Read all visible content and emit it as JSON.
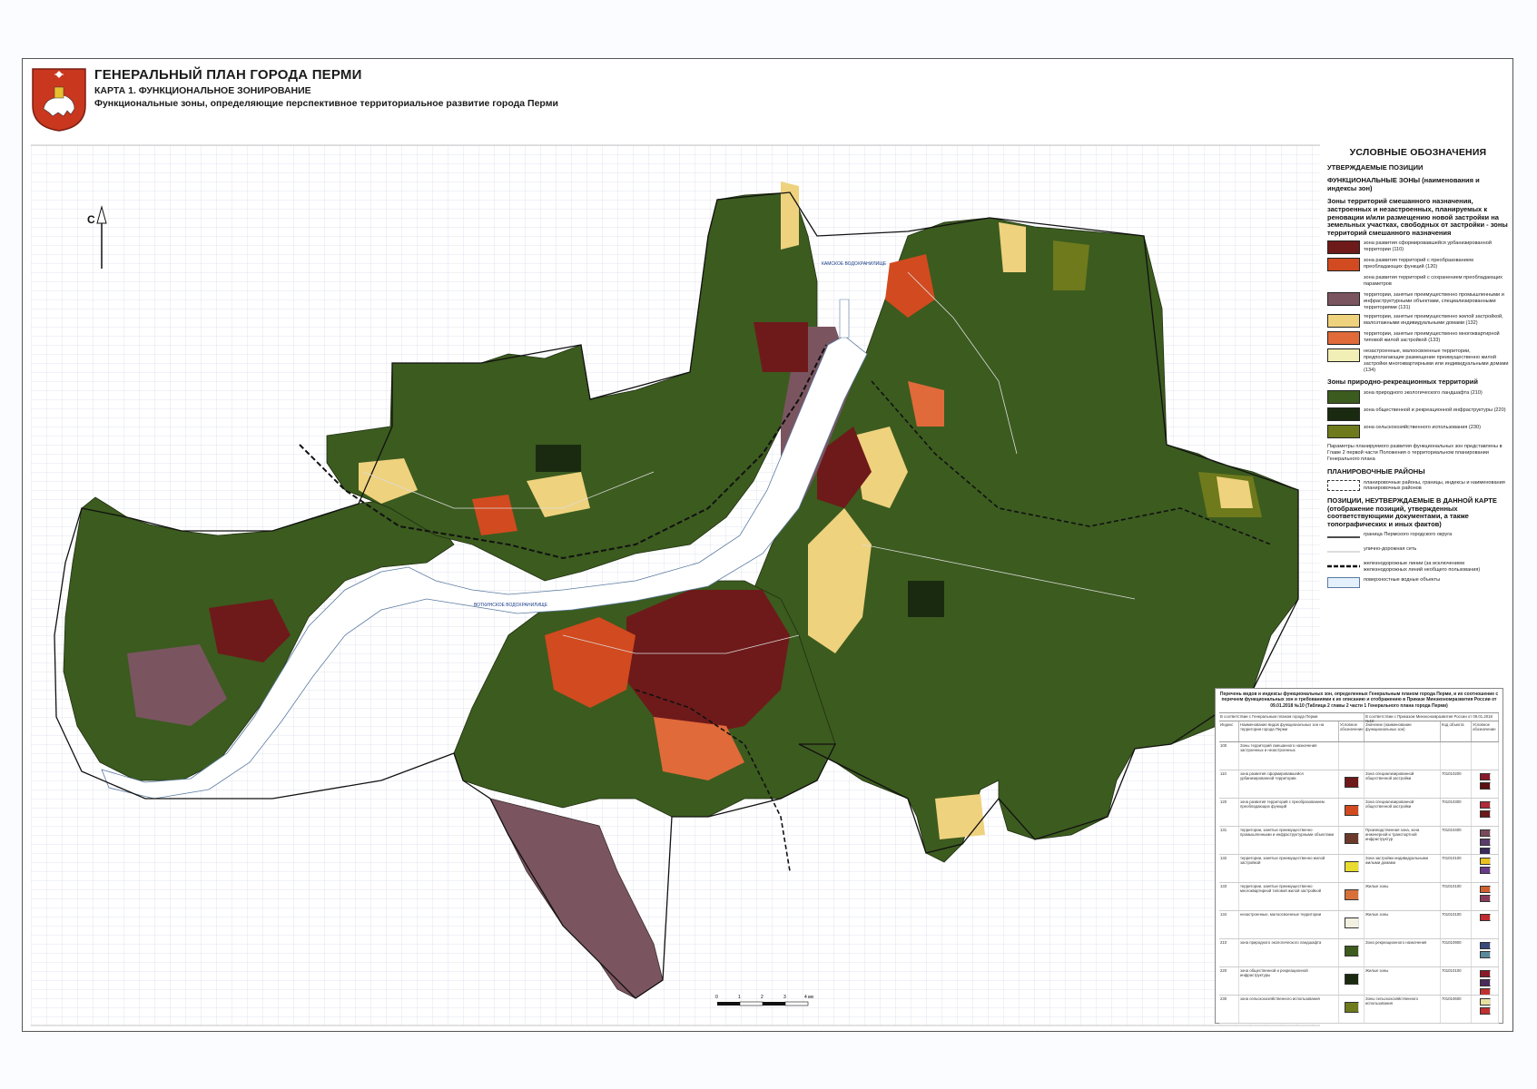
{
  "header": {
    "title": "ГЕНЕРАЛЬНЫЙ ПЛАН ГОРОДА ПЕРМИ",
    "subtitle": "КАРТА 1. ФУНКЦИОНАЛЬНОЕ ЗОНИРОВАНИЕ",
    "description": "Функциональные зоны, определяющие перспективное территориальное развитие города Перми"
  },
  "north_label": "С",
  "map_labels": {
    "reservoir_north": "КАМСКОЕ ВОДОХРАНИЛИЩЕ",
    "reservoir_south": "ВОТКИНСКОЕ ВОДОХРАНИЛИЩЕ"
  },
  "scale": {
    "ticks": [
      "0",
      "1",
      "2",
      "3",
      "4 км"
    ]
  },
  "legend": {
    "title": "УСЛОВНЫЕ ОБОЗНАЧЕНИЯ",
    "approved": "УТВЕРЖДАЕМЫЕ ПОЗИЦИИ",
    "func_zones": "ФУНКЦИОНАЛЬНЫЕ ЗОНЫ (наименования и индексы зон)",
    "mixed_head": "Зоны территорий смешанного назначения, застроенных и незастроенных, планируемых к реновации и/или размещению новой застройки на земельных участках, свободных от застройки - зоны территорий смешанного назначения",
    "items_mixed": [
      {
        "color": "#6e1a1a",
        "text": "зона развития сформировавшейся урбанизированной территории (110)"
      },
      {
        "color": "#d24a1f",
        "text": "зона развития территорий с преобразованием преобладающих функций (120)"
      },
      {
        "color": "#ffffff",
        "text": "зона развития территорий с сохранением преобладающих параметров"
      },
      {
        "color": "#7a5560",
        "text": "территории, занятые преимущественно промышленными и инфраструктурными объектами, специализированными территориями (131)"
      },
      {
        "color": "#efd27e",
        "text": "территории, занятые преимущественно жилой застройкой, малоэтажными индивидуальными домами (132)"
      },
      {
        "color": "#e06a3a",
        "text": "территории, занятые преимущественно многоквартирной типовой жилой застройкой (133)"
      },
      {
        "color": "#f2efb6",
        "text": "незастроенные, малоосвоенные территории, предполагающие размещение преимущественно жилой застройки многоквартирными или индивидуальными домами (134)"
      }
    ],
    "nature_head": "Зоны природно-рекреационных территорий",
    "items_nature": [
      {
        "color": "#3c5b1f",
        "text": "зона природного экологического ландшафта (210)"
      },
      {
        "color": "#1a2a10",
        "text": "зона общественной и рекреационной инфраструктуры (220)"
      },
      {
        "color": "#6e7a1c",
        "text": "зона сельскохозяйственного использования (230)"
      }
    ],
    "params_note": "Параметры планируемого развития функциональных зон представлены в Главе 2 первой части Положения о территориальном планировании Генерального плана",
    "districts_head": "ПЛАНИРОВОЧНЫЕ РАЙОНЫ",
    "districts_item": "планировочные районы, границы, индексы и наименования планировочных районов",
    "not_approved_head": "ПОЗИЦИИ, НЕУТВЕРЖДАЕМЫЕ В ДАННОЙ КАРТЕ (отображение позиций, утвержденных соответствующими документами, а также топографических и иных фактов)",
    "lines": [
      {
        "kind": "boundary",
        "text": "граница Пермского городского округа"
      },
      {
        "kind": "roads",
        "text": "улично-дорожная сеть"
      },
      {
        "kind": "rail",
        "text": "железнодорожные линии (за исключением железнодорожных линий необщего пользования)"
      },
      {
        "kind": "water",
        "text": "поверхностные водные объекты"
      }
    ]
  },
  "table": {
    "caption": "Перечень видов и индексы функциональных зон, определенных Генеральным планом города Перми, и их соотношение с перечнем функциональных зон и требованиями к их описанию и отображению в Приказе Минэкономразвития России от 09.01.2018 №10 (Таблица 2 главы 2 части 1 Генерального плана города Перми)",
    "head_left": "В соответствии с Генеральным планом города Перми",
    "head_right": "В соответствии с Приказом Минэкономразвития России от 09.01.2018 №10",
    "columns": [
      "Индекс",
      "Наименование видов функциональных зон на территории города Перми",
      "Условное обозначение",
      "Значение (наименование функциональных зон)",
      "Код объекта",
      "Условное обозначение"
    ],
    "rows": [
      {
        "index": "100",
        "name": "Зоны территорий смешанного назначения застроенных и незастроенных",
        "color": "",
        "right": "",
        "code": "",
        "colors": []
      },
      {
        "index": "110",
        "name": "зона развития сформировавшейся урбанизированной территории",
        "color": "#6e1a1a",
        "right": "Зона специализированной общественной застройки",
        "code": "701010200",
        "colors": [
          "#8a1a2a",
          "#5a1010"
        ]
      },
      {
        "index": "120",
        "name": "зона развития территорий с преобразованием преобладающих функций",
        "color": "#d24a1f",
        "right": "Зона специализированной общественной застройки",
        "code": "701010300",
        "colors": [
          "#b02a3a",
          "#6a1a1a"
        ]
      },
      {
        "index": "131",
        "name": "территории, занятые преимущественно промышленными и инфраструктурными объектами",
        "color": "#6b3a2a",
        "right": "Производственная зона, зона инженерной и транспортной инфраструктур",
        "code": "701010400",
        "colors": [
          "#7a4a5a",
          "#5a3a6a",
          "#3a2a5a"
        ]
      },
      {
        "index": "132",
        "name": "территории, занятые преимущественно жилой застройкой",
        "color": "#e8dc30",
        "right": "Зона застройки индивидуальными жилыми домами",
        "code": "701010100",
        "colors": [
          "#e8c020",
          "#6a3a8a"
        ]
      },
      {
        "index": "133",
        "name": "территории, занятые преимущественно многоквартирной типовой жилой застройкой",
        "color": "#d8703a",
        "right": "Жилые зоны",
        "code": "701010100",
        "colors": [
          "#d06030",
          "#8a3a5a"
        ]
      },
      {
        "index": "134",
        "name": "незастроенные, малоосвоенные территории",
        "color": "#f2f0e0",
        "right": "Жилые зоны",
        "code": "701010100",
        "colors": [
          "#c02a30"
        ]
      },
      {
        "index": "210",
        "name": "зона природного экологического ландшафта",
        "color": "#3c5b1f",
        "right": "Зона рекреационного назначения",
        "code": "701010900",
        "colors": [
          "#3a4a7a",
          "#5a8a9a"
        ]
      },
      {
        "index": "220",
        "name": "зона общественной и рекреационной инфраструктуры",
        "color": "#1a2a10",
        "right": "Жилые зоны",
        "code": "701010100",
        "colors": [
          "#8a1a2a",
          "#4a2a5a",
          "#c03030"
        ]
      },
      {
        "index": "230",
        "name": "зона сельскохозяйственного использования",
        "color": "#6e7a1c",
        "right": "Зоны сельскохозяйственного использования",
        "code": "701010600",
        "colors": [
          "#e8e0a0",
          "#c03030"
        ]
      }
    ]
  }
}
